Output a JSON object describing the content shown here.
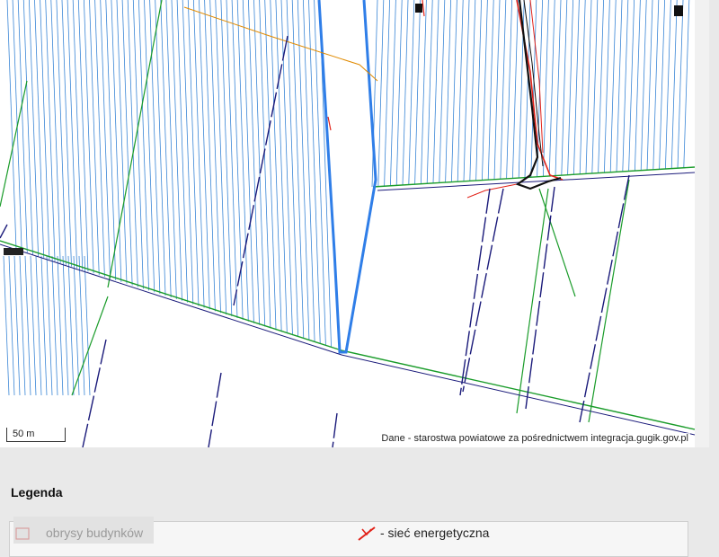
{
  "map": {
    "scale_label": "50 m",
    "attribution": "Dane - starostwa powiatowe za pośrednictwem integracja.gugik.gov.pl",
    "colors": {
      "parcel_lines": "#3a86d6",
      "selected_parcel": "#2f7ee8",
      "boundaries": "#1a9c2a",
      "roads": "#1a1a7a",
      "energy": "#e2231a",
      "gas": "#e08a00",
      "buildings": "#111111"
    }
  },
  "legend": {
    "title": "Legenda",
    "items": [
      {
        "label": "obrysy budynków",
        "icon": "building-outline-icon"
      },
      {
        "label": "- sieć energetyczna",
        "icon": "energy-network-icon"
      }
    ]
  }
}
